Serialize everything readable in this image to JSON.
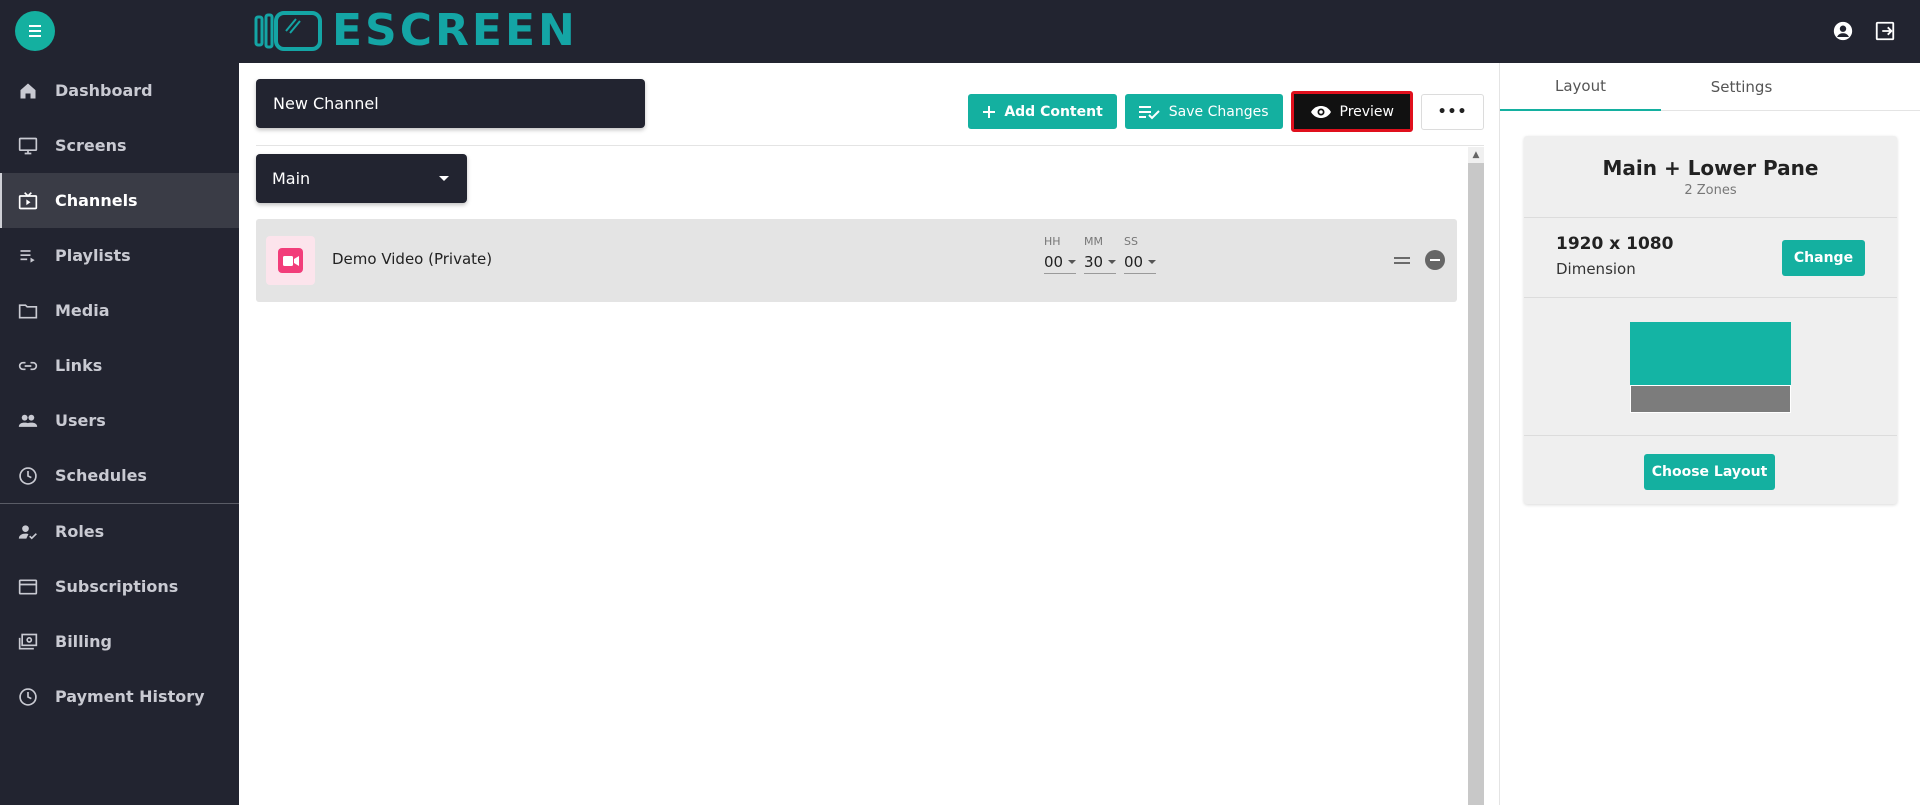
{
  "brand": {
    "logo_text": "ESCREEN",
    "accent": "#14b0a0",
    "logo_color": "#14a5a5"
  },
  "topbar": {
    "menu_icon": "hamburger-icon",
    "account_icon": "account-circle-icon",
    "logout_icon": "logout-icon"
  },
  "sidebar": {
    "items": [
      {
        "label": "Dashboard",
        "icon": "home-icon"
      },
      {
        "label": "Screens",
        "icon": "monitor-icon"
      },
      {
        "label": "Channels",
        "icon": "tv-channel-icon",
        "active": true
      },
      {
        "label": "Playlists",
        "icon": "playlist-icon"
      },
      {
        "label": "Media",
        "icon": "folder-icon"
      },
      {
        "label": "Links",
        "icon": "link-icon"
      },
      {
        "label": "Users",
        "icon": "users-icon"
      },
      {
        "label": "Schedules",
        "icon": "clock-icon"
      },
      {
        "label": "Roles",
        "icon": "user-check-icon"
      },
      {
        "label": "Subscriptions",
        "icon": "credit-card-icon"
      },
      {
        "label": "Billing",
        "icon": "billing-icon"
      },
      {
        "label": "Payment History",
        "icon": "history-icon"
      }
    ]
  },
  "editor": {
    "channel_name": "New Channel",
    "toolbar": {
      "add_content": "Add Content",
      "save_changes": "Save Changes",
      "preview": "Preview",
      "more": "•••"
    },
    "zone_select": "Main",
    "items": [
      {
        "title": "Demo Video (Private)",
        "icon": "video-camera-icon",
        "hh_label": "HH",
        "hh": "00",
        "mm_label": "MM",
        "mm": "30",
        "ss_label": "SS",
        "ss": "00"
      }
    ]
  },
  "right_panel": {
    "tabs": [
      "Layout",
      "Settings"
    ],
    "layout_name": "Main + Lower Pane",
    "zones": "2 Zones",
    "dimension_value": "1920 x 1080",
    "dimension_label": "Dimension",
    "change_button": "Change",
    "choose_layout_button": "Choose Layout",
    "zone_colors": {
      "main": "#14b4a4",
      "lower": "#7c7c7c"
    }
  }
}
